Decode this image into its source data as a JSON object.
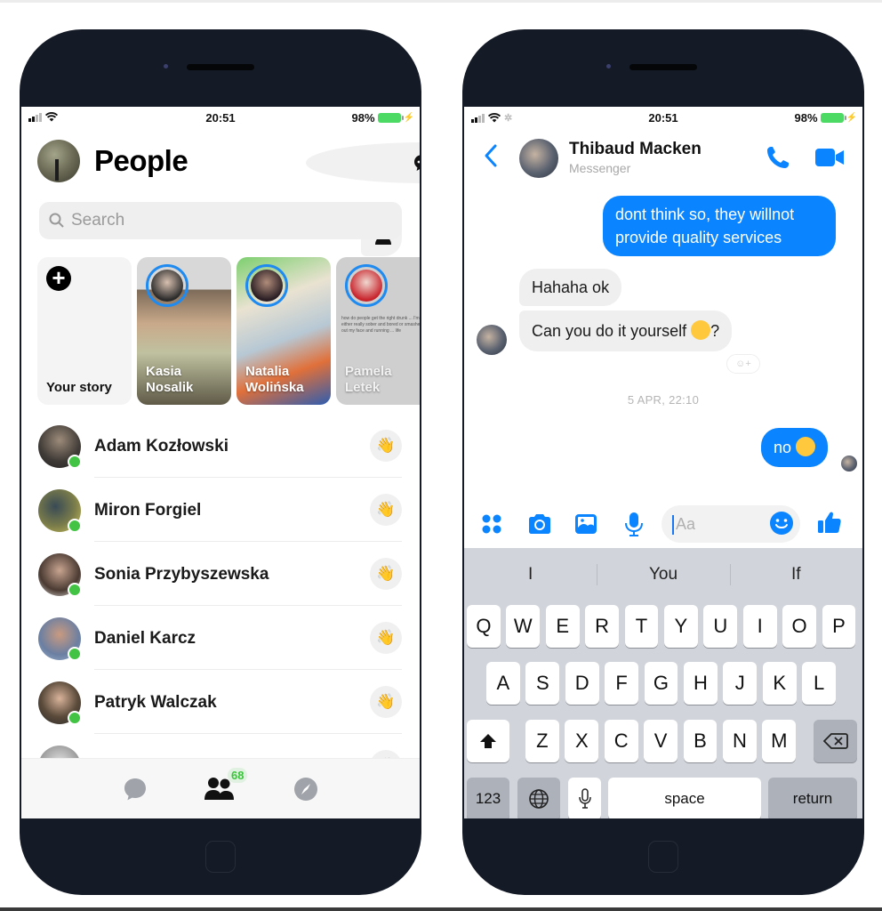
{
  "left_phone": {
    "status": {
      "time": "20:51",
      "battery": "98%"
    },
    "header": {
      "title": "People",
      "compose_icon": "chat-bubble-icon",
      "add_contact_icon": "add-person-icon"
    },
    "search": {
      "placeholder": "Search"
    },
    "stories": [
      {
        "label_line1": "Your story",
        "label_line2": "",
        "type": "own"
      },
      {
        "label_line1": "Kasia",
        "label_line2": "Nosalik"
      },
      {
        "label_line1": "Natalia",
        "label_line2": "Wolińska"
      },
      {
        "label_line1": "Pamela",
        "label_line2": "Letek",
        "preview_text": "how do people get the right drunk ... I'm either really sober and bored or smashed out my face and running ... life"
      }
    ],
    "people": [
      {
        "name": "Adam Kozłowski",
        "online": true
      },
      {
        "name": "Miron Forgiel",
        "online": true
      },
      {
        "name": "Sonia Przybyszewska",
        "online": true
      },
      {
        "name": "Daniel Karcz",
        "online": true
      },
      {
        "name": "Patryk Walczak",
        "online": true
      },
      {
        "name": "",
        "online": false
      }
    ],
    "tabbar": {
      "tabs": [
        {
          "name": "chats",
          "icon": "chat-icon"
        },
        {
          "name": "people",
          "icon": "people-icon",
          "badge": "68",
          "active": true
        },
        {
          "name": "discover",
          "icon": "compass-icon"
        }
      ]
    }
  },
  "right_phone": {
    "status": {
      "time": "20:51",
      "battery": "98%"
    },
    "header": {
      "contact_name": "Thibaud Macken",
      "subtitle": "Messenger"
    },
    "messages": [
      {
        "direction": "outgoing",
        "text": "dont think so, they willnot provide quality services"
      },
      {
        "direction": "incoming",
        "text": "Hahaha ok"
      },
      {
        "direction": "incoming",
        "text": "Can you do it yourself",
        "emoji": "grimacing-face",
        "suffix": "?"
      },
      {
        "type": "timestamp",
        "text": "5 APR, 22:10"
      },
      {
        "direction": "outgoing",
        "text": "no",
        "emoji": "confused-face"
      }
    ],
    "composer": {
      "placeholder": "Aa"
    },
    "keyboard": {
      "suggestions": [
        "I",
        "You",
        "If"
      ],
      "row1": [
        "Q",
        "W",
        "E",
        "R",
        "T",
        "Y",
        "U",
        "I",
        "O",
        "P"
      ],
      "row2": [
        "A",
        "S",
        "D",
        "F",
        "G",
        "H",
        "J",
        "K",
        "L"
      ],
      "row3": [
        "Z",
        "X",
        "C",
        "V",
        "B",
        "N",
        "M"
      ],
      "numbers_label": "123",
      "space_label": "space",
      "return_label": "return"
    },
    "colors": {
      "accent": "#0a84ff",
      "online": "#42c343"
    }
  }
}
